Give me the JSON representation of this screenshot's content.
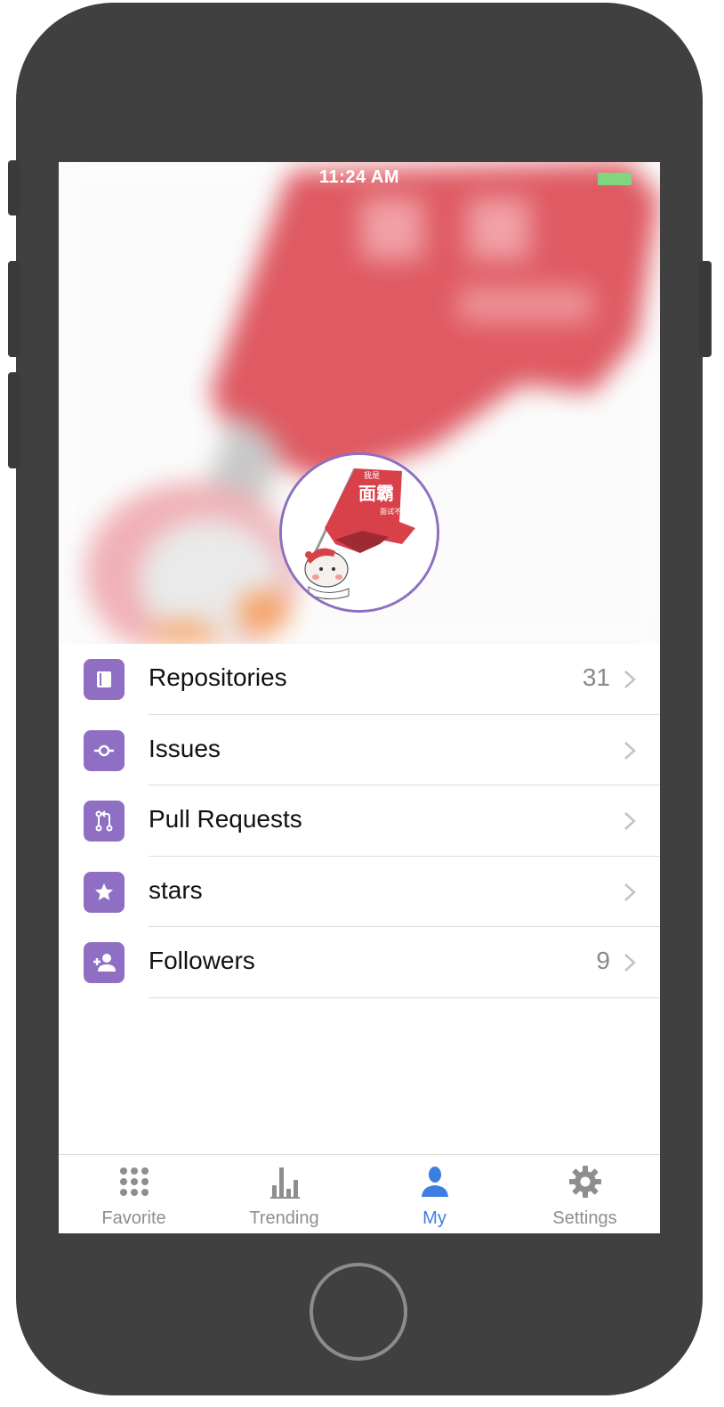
{
  "status_bar": {
    "time": "11:24 AM"
  },
  "profile": {
    "avatar_icon": "flag-mascot-avatar",
    "flag_top_text": "我是",
    "flag_main_text": "面霸",
    "flag_sub_text": "面试不怕!"
  },
  "menu": {
    "items": [
      {
        "label": "Repositories",
        "count": "31",
        "icon": "repo-book-icon"
      },
      {
        "label": "Issues",
        "count": "",
        "icon": "issue-commit-icon"
      },
      {
        "label": "Pull Requests",
        "count": "",
        "icon": "pull-request-icon"
      },
      {
        "label": "stars",
        "count": "",
        "icon": "star-icon"
      },
      {
        "label": "Followers",
        "count": "9",
        "icon": "add-person-icon"
      }
    ]
  },
  "tabbar": {
    "tabs": [
      {
        "label": "Favorite",
        "icon": "grid-dots-icon",
        "active": false
      },
      {
        "label": "Trending",
        "icon": "bar-chart-icon",
        "active": false
      },
      {
        "label": "My",
        "icon": "person-icon",
        "active": true
      },
      {
        "label": "Settings",
        "icon": "gear-icon",
        "active": false
      }
    ]
  },
  "colors": {
    "accent_purple": "#8f6fc3",
    "active_tab_blue": "#3d7fe0",
    "battery_green": "#7fd67f",
    "flag_red": "#d8404a",
    "phone_frame": "#404040"
  }
}
